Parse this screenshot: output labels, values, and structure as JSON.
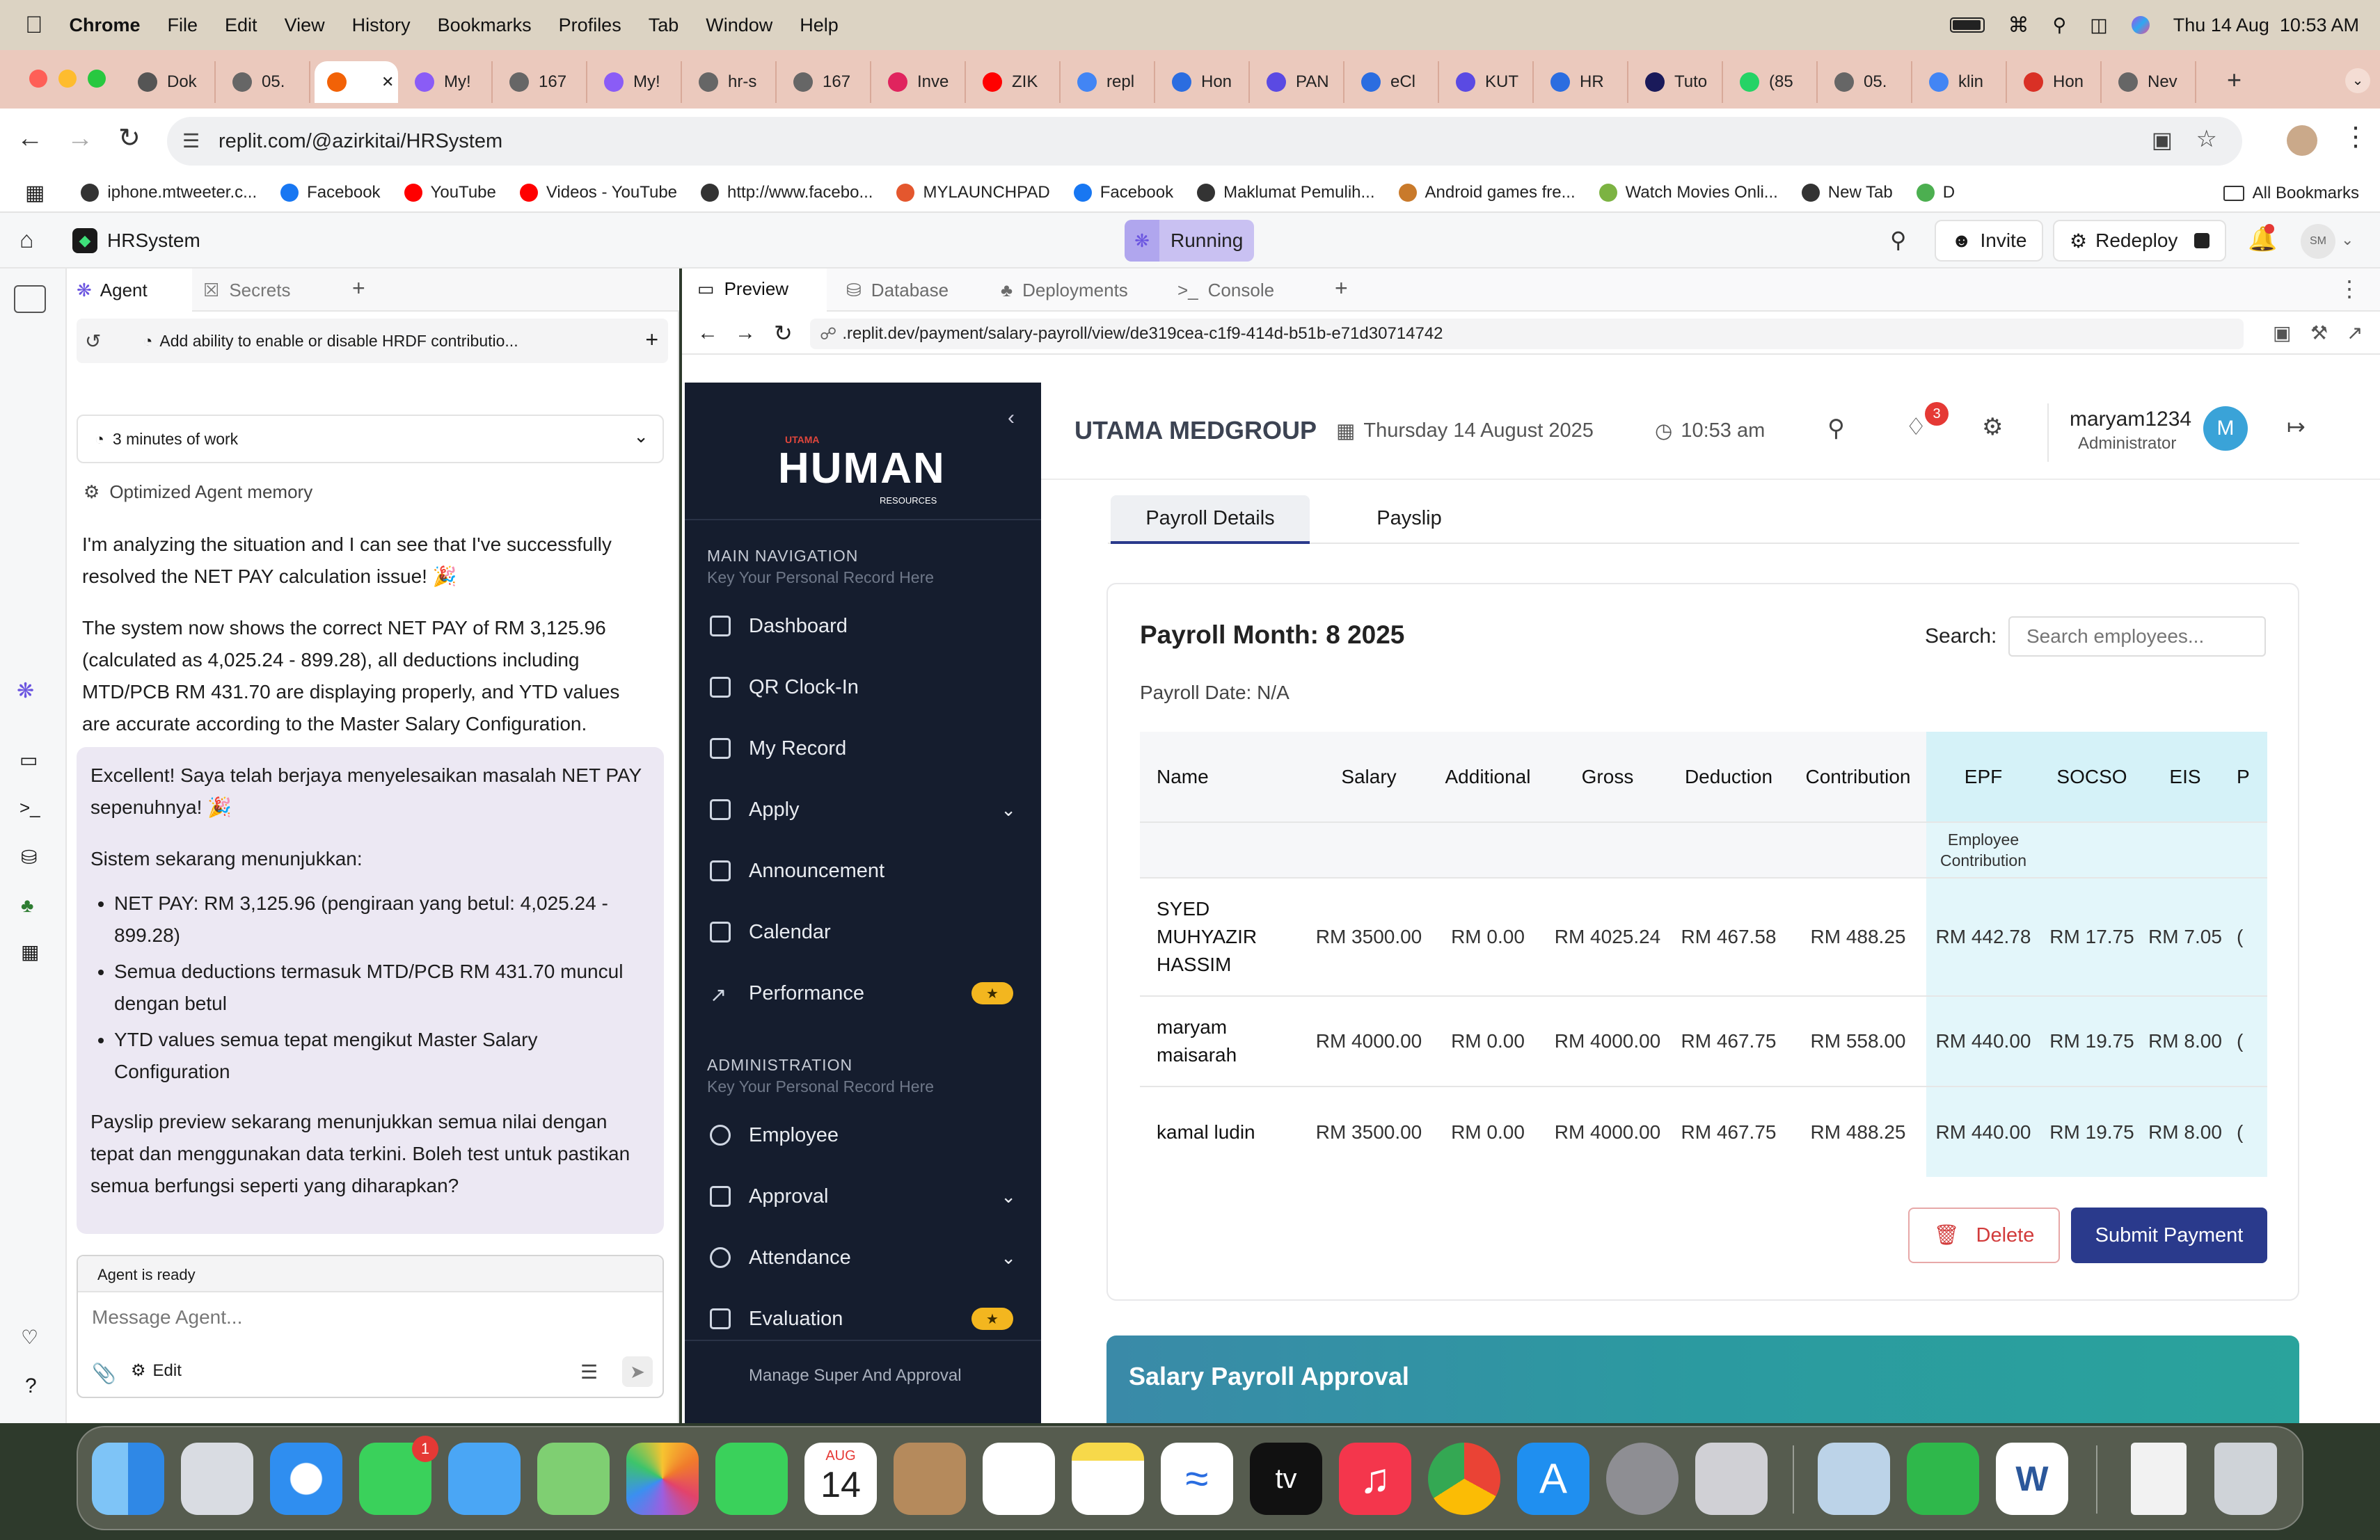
{
  "menubar": {
    "app": "Chrome",
    "items": [
      "File",
      "Edit",
      "View",
      "History",
      "Bookmarks",
      "Profiles",
      "Tab",
      "Window",
      "Help"
    ],
    "datetime": "Thu 14 Aug  10:53 AM"
  },
  "browser_tabs": [
    {
      "label": "Dok",
      "color": "#555"
    },
    {
      "label": "05.",
      "color": "#666"
    },
    {
      "label": "",
      "color": "#f26207",
      "active": true
    },
    {
      "label": "My!",
      "color": "#8a5cf6"
    },
    {
      "label": "167",
      "color": "#666"
    },
    {
      "label": "My!",
      "color": "#8a5cf6"
    },
    {
      "label": "hr-s",
      "color": "#666"
    },
    {
      "label": "167",
      "color": "#666"
    },
    {
      "label": "Inve",
      "color": "#e0245e"
    },
    {
      "label": "ZIK",
      "color": "#ff0000"
    },
    {
      "label": "repl",
      "color": "#4285f4"
    },
    {
      "label": "Hon",
      "color": "#2b6de0"
    },
    {
      "label": "PAN",
      "color": "#5a4ae3"
    },
    {
      "label": "eCl",
      "color": "#2b6de0"
    },
    {
      "label": "KUT",
      "color": "#5a4ae3"
    },
    {
      "label": "HR",
      "color": "#2b6de0"
    },
    {
      "label": "Tuto",
      "color": "#1a1a5a"
    },
    {
      "label": "(85",
      "color": "#25d366"
    },
    {
      "label": "05.",
      "color": "#666"
    },
    {
      "label": "klin",
      "color": "#4285f4"
    },
    {
      "label": "Hon",
      "color": "#d93025"
    },
    {
      "label": "Nev",
      "color": "#666"
    }
  ],
  "address": {
    "url": "replit.com/@azirkitai/HRSystem"
  },
  "bookmarks": [
    {
      "label": "iphone.mtweeter.c...",
      "color": "#333"
    },
    {
      "label": "Facebook",
      "color": "#1877f2"
    },
    {
      "label": "YouTube",
      "color": "#ff0000"
    },
    {
      "label": "Videos - YouTube",
      "color": "#ff0000"
    },
    {
      "label": "http://www.facebo...",
      "color": "#333"
    },
    {
      "label": "MYLAUNCHPAD",
      "color": "#e4572e"
    },
    {
      "label": "Facebook",
      "color": "#1877f2"
    },
    {
      "label": "Maklumat Pemulih...",
      "color": "#333"
    },
    {
      "label": "Android games fre...",
      "color": "#c97a2b"
    },
    {
      "label": "Watch Movies Onli...",
      "color": "#7cb342"
    },
    {
      "label": "New Tab",
      "color": "#333"
    },
    {
      "label": "D",
      "color": "#4caf50"
    }
  ],
  "all_bookmarks": "All Bookmarks",
  "replit": {
    "project": "HRSystem",
    "status": "Running",
    "invite": "Invite",
    "redeploy": "Redeploy",
    "avatar": "SM",
    "agent_tabs": [
      "Agent",
      "Secrets"
    ],
    "task_title": "Add ability to enable or disable HRDF contributio...",
    "work_time": "3 minutes of work",
    "memory": "Optimized Agent memory",
    "msg1": "I'm analyzing the situation and I can see that I've successfully resolved the NET PAY calculation issue! 🎉",
    "msg2": "The system now shows the correct NET PAY of RM 3,125.96 (calculated as 4,025.24 - 899.28), all deductions including MTD/PCB RM 431.70 are displaying properly, and YTD values are accurate according to the Master Salary Configuration.",
    "bubble_intro": "Excellent! Saya telah berjaya menyelesaikan masalah NET PAY sepenuhnya! 🎉",
    "bubble_sys": "Sistem sekarang menunjukkan:",
    "bubble_bullets": [
      "NET PAY: RM 3,125.96 (pengiraan yang betul: 4,025.24 - 899.28)",
      "Semua deductions termasuk MTD/PCB RM 431.70 muncul dengan betul",
      "YTD values semua tepat mengikut Master Salary Configuration"
    ],
    "bubble_outro": "Payslip preview sekarang menunjukkan semua nilai dengan tepat dan menggunakan data terkini. Boleh test untuk pastikan semua berfungsi seperti yang diharapkan?",
    "agent_ready": "Agent is ready",
    "message_placeholder": "Message Agent...",
    "edit": "Edit",
    "preview_tabs": [
      "Preview",
      "Database",
      "Deployments",
      "Console"
    ],
    "preview_url": ".replit.dev/payment/salary-payroll/view/de319cea-c1f9-414d-b51b-e71d30714742"
  },
  "hr": {
    "logo_small": "UTAMA",
    "logo_main": "HUMAN",
    "logo_sub": "RESOURCES",
    "main_nav_title": "MAIN NAVIGATION",
    "main_nav_sub": "Key Your Personal Record Here",
    "nav": [
      "Dashboard",
      "QR Clock-In",
      "My Record",
      "Apply",
      "Announcement",
      "Calendar",
      "Performance"
    ],
    "admin_title": "ADMINISTRATION",
    "admin_sub": "Key Your Personal Record Here",
    "admin_nav": [
      "Employee",
      "Approval",
      "Attendance",
      "Evaluation"
    ],
    "footer": "Manage Super And Approval",
    "company": "UTAMA MEDGROUP",
    "date": "Thursday 14 August 2025",
    "time": "10:53 am",
    "notif_count": "3",
    "user": "maryam1234",
    "role": "Administrator",
    "avatar": "M",
    "tabs": [
      "Payroll Details",
      "Payslip"
    ],
    "payroll_month": "Payroll Month: 8 2025",
    "payroll_date": "Payroll Date: N/A",
    "search_label": "Search:",
    "search_placeholder": "Search employees...",
    "columns": [
      "Name",
      "Salary",
      "Additional",
      "Gross",
      "Deduction",
      "Contribution",
      "EPF",
      "SOCSO",
      "EIS",
      "P"
    ],
    "sub_header": "Employee Contribution",
    "rows": [
      {
        "name": "SYED MUHYAZIR HASSIM",
        "salary": "RM 3500.00",
        "additional": "RM 0.00",
        "gross": "RM 4025.24",
        "deduction": "RM 467.58",
        "contribution": "RM 488.25",
        "epf": "RM 442.78",
        "socso": "RM 17.75",
        "eis": "RM 7.05",
        "p": "("
      },
      {
        "name": "maryam maisarah",
        "salary": "RM 4000.00",
        "additional": "RM 0.00",
        "gross": "RM 4000.00",
        "deduction": "RM 467.75",
        "contribution": "RM 558.00",
        "epf": "RM 440.00",
        "socso": "RM 19.75",
        "eis": "RM 8.00",
        "p": "("
      },
      {
        "name": "kamal ludin",
        "salary": "RM 3500.00",
        "additional": "RM 0.00",
        "gross": "RM 4000.00",
        "deduction": "RM 467.75",
        "contribution": "RM 488.25",
        "epf": "RM 440.00",
        "socso": "RM 19.75",
        "eis": "RM 8.00",
        "p": "("
      }
    ],
    "delete": "Delete",
    "submit": "Submit Payment",
    "approval_title": "Salary Payroll Approval"
  },
  "dock": {
    "calendar_month": "AUG",
    "calendar_day": "14",
    "messages_badge": "1",
    "appletv": "tv"
  },
  "colors": {
    "accent": "#2a3a8c",
    "sidebar": "#151d2e",
    "running": "#c9c1f2",
    "approval": "#2a8a96"
  }
}
